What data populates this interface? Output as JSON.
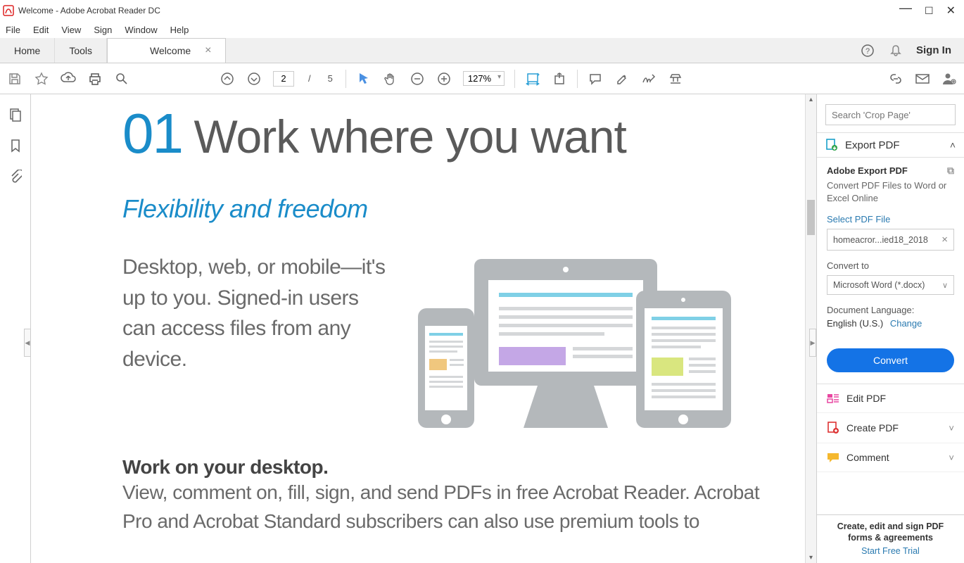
{
  "title": "Welcome - Adobe Acrobat Reader DC",
  "menu": [
    "File",
    "Edit",
    "View",
    "Sign",
    "Window",
    "Help"
  ],
  "tabs": {
    "home": "Home",
    "tools": "Tools",
    "active": "Welcome"
  },
  "signin": "Sign In",
  "toolbar": {
    "page_current": "2",
    "page_sep": "/",
    "page_total": "5",
    "zoom": "127%"
  },
  "doc": {
    "num": "01",
    "heading": "Work where you want",
    "subhead": "Flexibility and freedom",
    "body1": "Desktop, web, or mobile—it's up to you. Signed-in users can access files from any device.",
    "sect_head": "Work on your desktop.",
    "sect_body": "View, comment on, fill, sign, and send PDFs in free Acrobat Reader. Acrobat Pro and Acrobat Standard subscribers can also use premium tools to"
  },
  "rpanel": {
    "search_ph": "Search 'Crop Page'",
    "export_head": "Export PDF",
    "export_title": "Adobe Export PDF",
    "export_desc": "Convert PDF Files to Word or Excel Online",
    "select_lbl": "Select PDF File",
    "file": "homeacror...ied18_2018",
    "convert_lbl": "Convert to",
    "convert_fmt": "Microsoft Word (*.docx)",
    "lang_lbl": "Document Language:",
    "lang_val": "English (U.S.)",
    "lang_change": "Change",
    "convert_btn": "Convert",
    "tool_edit": "Edit PDF",
    "tool_create": "Create PDF",
    "tool_comment": "Comment",
    "promo1": "Create, edit and sign PDF forms & agreements",
    "promo2": "Start Free Trial"
  }
}
